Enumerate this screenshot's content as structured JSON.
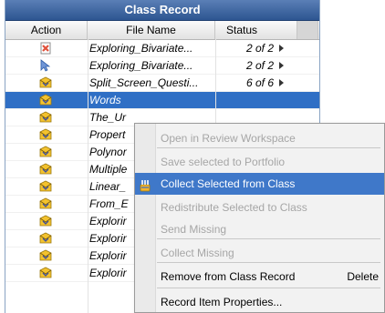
{
  "panel": {
    "title": "Class Record"
  },
  "columns": {
    "action": "Action",
    "file_name": "File Name",
    "status": "Status"
  },
  "rows": [
    {
      "icon": "collected-doc-icon",
      "file": "Exploring_Bivariate...",
      "status": "2 of 2"
    },
    {
      "icon": "cursor-doc-icon",
      "file": "Exploring_Bivariate...",
      "status": "2 of 2"
    },
    {
      "icon": "envelope-icon",
      "file": "Split_Screen_Questi...",
      "status": "6 of 6"
    },
    {
      "icon": "envelope-icon",
      "file": "Words",
      "status": "",
      "selected": true
    },
    {
      "icon": "envelope-icon",
      "file": "The_Ur",
      "status": ""
    },
    {
      "icon": "envelope-icon",
      "file": "Propert",
      "status": ""
    },
    {
      "icon": "envelope-icon",
      "file": "Polynor",
      "status": ""
    },
    {
      "icon": "envelope-icon",
      "file": "Multiple",
      "status": ""
    },
    {
      "icon": "envelope-icon",
      "file": "Linear_",
      "status": ""
    },
    {
      "icon": "envelope-icon",
      "file": "From_E",
      "status": ""
    },
    {
      "icon": "envelope-icon",
      "file": "Explorir",
      "status": ""
    },
    {
      "icon": "envelope-icon",
      "file": "Explorir",
      "status": ""
    },
    {
      "icon": "envelope-icon",
      "file": "Explorir",
      "status": ""
    },
    {
      "icon": "envelope-icon",
      "file": "Explorir",
      "status": ""
    }
  ],
  "context_menu": {
    "items": [
      {
        "label": "Open in Review Workspace",
        "disabled": true
      },
      {
        "label": "Save selected to Portfolio",
        "disabled": true
      },
      {
        "label": "Collect Selected from Class",
        "highlighted": true,
        "icon": "collect-icon"
      },
      {
        "label": "Redistribute Selected to Class",
        "disabled": true
      },
      {
        "label": "Send Missing",
        "disabled": true
      },
      {
        "label": "Collect Missing",
        "disabled": true
      },
      {
        "label": "Remove from Class Record",
        "accelerator": "Delete"
      },
      {
        "label": "Record Item Properties..."
      }
    ]
  },
  "colors": {
    "title_bar": "#3c64a0",
    "selection": "#2f6fc5",
    "menu_highlight": "#3f78c9"
  }
}
